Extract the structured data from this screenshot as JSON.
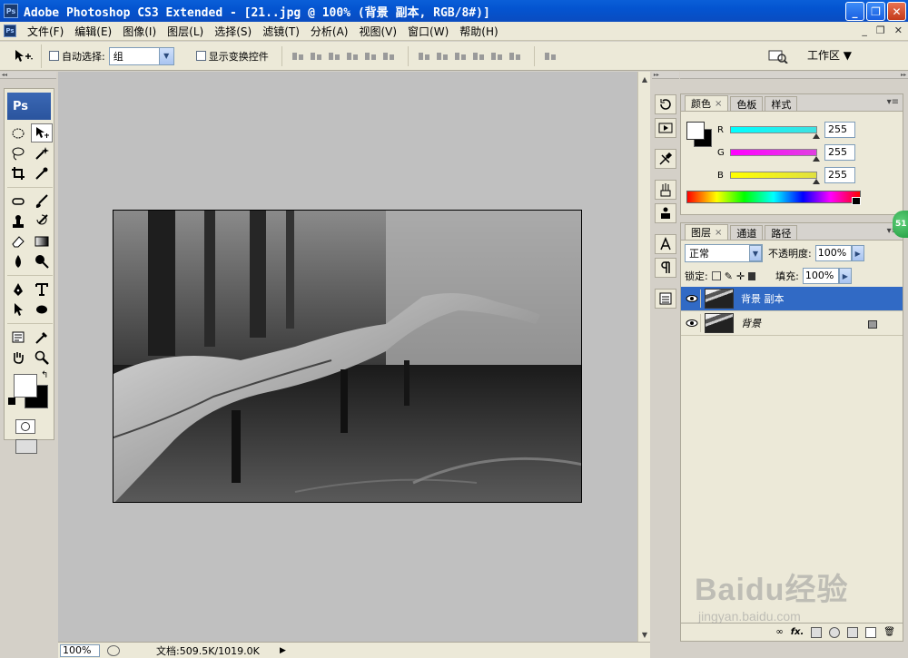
{
  "window": {
    "title": "Adobe Photoshop CS3 Extended - [21..jpg @ 100% (背景 副本, RGB/8#)]",
    "app_icon": "Ps",
    "controls": {
      "minimize": "_",
      "restore": "❐",
      "close": "✕"
    }
  },
  "menu": {
    "items": [
      "文件(F)",
      "编辑(E)",
      "图像(I)",
      "图层(L)",
      "选择(S)",
      "滤镜(T)",
      "分析(A)",
      "视图(V)",
      "窗口(W)",
      "帮助(H)"
    ],
    "doc_controls": [
      "_",
      "❐",
      "✕"
    ]
  },
  "options": {
    "auto_select_label": "自动选择:",
    "auto_select_value": "组",
    "show_transform_label": "显示变换控件",
    "workspace_label": "工作区 ▼"
  },
  "toolbox": {
    "logo": "Ps",
    "foreground": "#ffffff",
    "background": "#000000"
  },
  "status": {
    "zoom": "100%",
    "doc_info": "文档:509.5K/1019.0K"
  },
  "color_panel": {
    "tabs": [
      "颜色",
      "色板",
      "样式"
    ],
    "channels": [
      {
        "label": "R",
        "value": "255",
        "color": "#00cccc"
      },
      {
        "label": "G",
        "value": "255",
        "color": "#cc00cc"
      },
      {
        "label": "B",
        "value": "255",
        "color": "#cccc00"
      }
    ]
  },
  "layers_panel": {
    "tabs": [
      "图层",
      "通道",
      "路径"
    ],
    "blend_mode": "正常",
    "opacity_label": "不透明度:",
    "opacity_value": "100%",
    "lock_label": "锁定:",
    "fill_label": "填充:",
    "fill_value": "100%",
    "layers": [
      {
        "name": "背景 副本",
        "selected": true,
        "locked": false
      },
      {
        "name": "背景",
        "selected": false,
        "locked": true
      }
    ],
    "footer_icons": [
      "link-icon",
      "fx-icon",
      "mask-icon",
      "adjustment-icon",
      "folder-icon",
      "new-layer-icon",
      "trash-icon"
    ]
  },
  "badge": "51",
  "watermark": {
    "brand": "Baidu经验",
    "url": "jingyan.baidu.com"
  }
}
